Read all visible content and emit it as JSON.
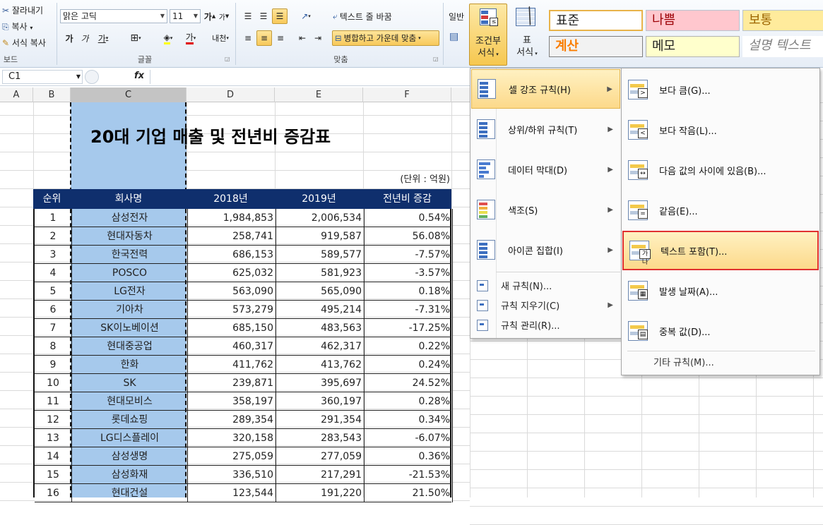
{
  "ribbon": {
    "clipboard": {
      "cut": "잘라내기",
      "copy": "복사",
      "format_painter": "서식 복사",
      "group": "보드"
    },
    "font": {
      "name": "맑은 고딕",
      "size": "11",
      "grow": "가",
      "shrink": "가",
      "bold": "가",
      "italic": "가",
      "underline": "가",
      "phonetic": "내천",
      "group": "글꼴"
    },
    "align": {
      "wrap_text": "텍스트 줄 바꿈",
      "merge_center": "병합하고 가운데 맞춤",
      "group": "맞춤"
    },
    "number": {
      "format": "일반"
    },
    "conditional_format": {
      "line1": "조건부",
      "line2": "서식"
    },
    "table_format": {
      "line1": "표",
      "line2": "서식"
    },
    "styles": {
      "normal": "표준",
      "bad": "나쁨",
      "neutral": "보통",
      "calc": "계산",
      "memo": "메모",
      "explanatory": "설명 텍스트"
    }
  },
  "formula_bar": {
    "name_box": "C1",
    "fx": "fx",
    "value": ""
  },
  "columns": [
    "A",
    "B",
    "C",
    "D",
    "E",
    "F"
  ],
  "sheet": {
    "title": "20대 기업 매출 및 전년비 증감표",
    "unit": "(단위 : 억원)",
    "headers": [
      "순위",
      "회사명",
      "2018년",
      "2019년",
      "전년비 증감"
    ],
    "rows": [
      [
        "1",
        "삼성전자",
        "1,984,853",
        "2,006,534",
        "0.54%"
      ],
      [
        "2",
        "현대자동차",
        "258,741",
        "919,587",
        "56.08%"
      ],
      [
        "3",
        "한국전력",
        "686,153",
        "589,577",
        "-7.57%"
      ],
      [
        "4",
        "POSCO",
        "625,032",
        "581,923",
        "-3.57%"
      ],
      [
        "5",
        "LG전자",
        "563,090",
        "565,090",
        "0.18%"
      ],
      [
        "6",
        "기아차",
        "573,279",
        "495,214",
        "-7.31%"
      ],
      [
        "7",
        "SK이노베이션",
        "685,150",
        "483,563",
        "-17.25%"
      ],
      [
        "8",
        "현대중공업",
        "460,317",
        "462,317",
        "0.22%"
      ],
      [
        "9",
        "한화",
        "411,762",
        "413,762",
        "0.24%"
      ],
      [
        "10",
        "SK",
        "239,871",
        "395,697",
        "24.52%"
      ],
      [
        "11",
        "현대모비스",
        "358,197",
        "360,197",
        "0.28%"
      ],
      [
        "12",
        "롯데쇼핑",
        "289,354",
        "291,354",
        "0.34%"
      ],
      [
        "13",
        "LG디스플레이",
        "320,158",
        "283,543",
        "-6.07%"
      ],
      [
        "14",
        "삼성생명",
        "275,059",
        "277,059",
        "0.36%"
      ],
      [
        "15",
        "삼성화재",
        "336,510",
        "217,291",
        "-21.53%"
      ],
      [
        "16",
        "현대건설",
        "123,544",
        "191,220",
        "21.50%"
      ]
    ]
  },
  "cf_menu": {
    "items": [
      {
        "label": "셀 강조 규칙(H)",
        "icon": "highlight-rules-icon"
      },
      {
        "label": "상위/하위 규칙(T)",
        "icon": "top-bottom-icon"
      },
      {
        "label": "데이터 막대(D)",
        "icon": "data-bars-icon"
      },
      {
        "label": "색조(S)",
        "icon": "color-scales-icon"
      },
      {
        "label": "아이콘 집합(I)",
        "icon": "icon-sets-icon"
      }
    ],
    "small_items": [
      {
        "label": "새 규칙(N)...",
        "icon": "new-rule-icon"
      },
      {
        "label": "규칙 지우기(C)",
        "icon": "clear-rules-icon"
      },
      {
        "label": "규칙 관리(R)...",
        "icon": "manage-rules-icon"
      }
    ]
  },
  "highlight_submenu": {
    "items": [
      {
        "label": "보다 큼(G)...",
        "icon": "greater-than-icon"
      },
      {
        "label": "보다 작음(L)...",
        "icon": "less-than-icon"
      },
      {
        "label": "다음 값의 사이에 있음(B)...",
        "icon": "between-icon"
      },
      {
        "label": "같음(E)...",
        "icon": "equal-to-icon"
      },
      {
        "label": "텍스트 포함(T)...",
        "icon": "text-contains-icon"
      },
      {
        "label": "발생 날짜(A)...",
        "icon": "date-occurring-icon"
      },
      {
        "label": "중복 값(D)...",
        "icon": "duplicate-values-icon"
      }
    ],
    "more": "기타 규칙(M)..."
  },
  "colors": {
    "header_fill": "#0f2f6d",
    "selection_fill": "#a6c9ec",
    "highlight_border": "#e03030",
    "menu_highlight": "#fcd98a"
  }
}
